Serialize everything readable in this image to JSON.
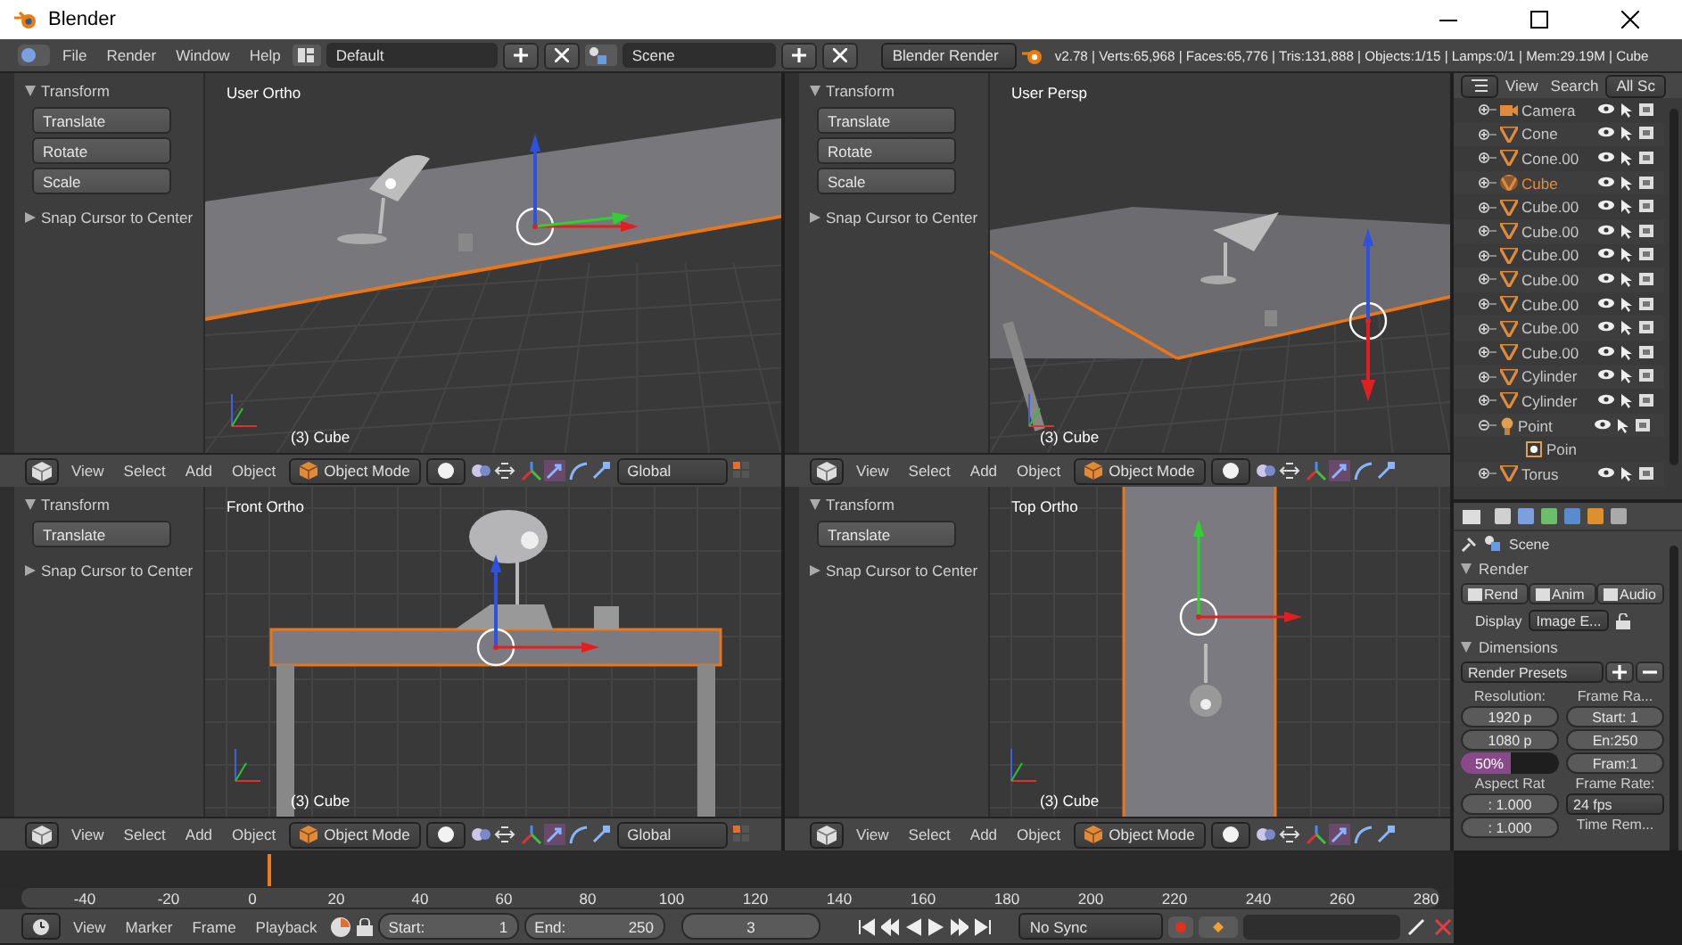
{
  "window": {
    "title": "Blender"
  },
  "info_header": {
    "menus": [
      "File",
      "Render",
      "Window",
      "Help"
    ],
    "screen_layout": "Default",
    "scene": "Scene",
    "render_engine": "Blender Render",
    "stats": "v2.78 | Verts:65,968 | Faces:65,776 | Tris:131,888 | Objects:1/15 | Lamps:0/1 | Mem:29.19M | Cube"
  },
  "viewports": [
    {
      "kind": "user_ortho",
      "view_label": "User Ortho",
      "object_label": "(3) Cube",
      "tool_shelf": {
        "panel": "Transform",
        "tools": [
          "Translate",
          "Rotate",
          "Scale"
        ],
        "collapsed_panel": "Snap Cursor to Center"
      },
      "header": {
        "menus": [
          "View",
          "Select",
          "Add",
          "Object"
        ],
        "mode": "Object Mode",
        "orientation": "Global"
      }
    },
    {
      "kind": "user_persp",
      "view_label": "User Persp",
      "object_label": "(3) Cube",
      "tool_shelf": {
        "panel": "Transform",
        "tools": [
          "Translate",
          "Rotate",
          "Scale"
        ],
        "collapsed_panel": "Snap Cursor to Center"
      },
      "header": {
        "menus": [
          "View",
          "Select",
          "Add",
          "Object"
        ],
        "mode": "Object Mode"
      }
    },
    {
      "kind": "front_ortho",
      "view_label": "Front Ortho",
      "object_label": "(3) Cube",
      "tool_shelf": {
        "panel": "Transform",
        "tools": [
          "Translate"
        ],
        "collapsed_panel": "Snap Cursor to Center"
      },
      "header": {
        "menus": [
          "View",
          "Select",
          "Add",
          "Object"
        ],
        "mode": "Object Mode",
        "orientation": "Global"
      }
    },
    {
      "kind": "top_ortho",
      "view_label": "Top Ortho",
      "object_label": "(3) Cube",
      "tool_shelf": {
        "panel": "Transform",
        "tools": [
          "Translate"
        ],
        "collapsed_panel": "Snap Cursor to Center"
      },
      "header": {
        "menus": [
          "View",
          "Select",
          "Add",
          "Object"
        ],
        "mode": "Object Mode"
      }
    }
  ],
  "outliner": {
    "menus": [
      "View",
      "Search"
    ],
    "filter": "All Sc",
    "items": [
      {
        "name": "Camera",
        "kind": "camera",
        "selected": false,
        "expanded": false
      },
      {
        "name": "Cone",
        "kind": "mesh",
        "selected": false,
        "expanded": false
      },
      {
        "name": "Cone.00",
        "kind": "mesh",
        "selected": false,
        "expanded": false
      },
      {
        "name": "Cube",
        "kind": "mesh",
        "selected": true,
        "expanded": false
      },
      {
        "name": "Cube.00",
        "kind": "mesh",
        "selected": false,
        "expanded": false
      },
      {
        "name": "Cube.00",
        "kind": "mesh",
        "selected": false,
        "expanded": false
      },
      {
        "name": "Cube.00",
        "kind": "mesh",
        "selected": false,
        "expanded": false
      },
      {
        "name": "Cube.00",
        "kind": "mesh",
        "selected": false,
        "expanded": false
      },
      {
        "name": "Cube.00",
        "kind": "mesh",
        "selected": false,
        "expanded": false
      },
      {
        "name": "Cube.00",
        "kind": "mesh",
        "selected": false,
        "expanded": false
      },
      {
        "name": "Cube.00",
        "kind": "mesh",
        "selected": false,
        "expanded": false
      },
      {
        "name": "Cylinder",
        "kind": "mesh",
        "selected": false,
        "expanded": false
      },
      {
        "name": "Cylinder",
        "kind": "mesh",
        "selected": false,
        "expanded": false
      },
      {
        "name": "Point",
        "kind": "lamp",
        "selected": false,
        "expanded": true,
        "children": [
          {
            "name": "Poin",
            "kind": "lamp_data",
            "selected": false
          }
        ]
      },
      {
        "name": "Torus",
        "kind": "mesh",
        "selected": false,
        "expanded": false
      }
    ]
  },
  "properties": {
    "context": "Scene",
    "render_panel": {
      "title": "Render",
      "buttons": [
        "Rend",
        "Anim",
        "Audio"
      ],
      "display_label": "Display",
      "display_value": "Image E..."
    },
    "dimensions_panel": {
      "title": "Dimensions",
      "presets": "Render Presets",
      "resolution_label": "Resolution:",
      "resolution_x": "1920 p",
      "resolution_y": "1080 p",
      "percentage": "50%",
      "level": 0.5,
      "frame_range_label": "Frame Ra...",
      "frame_start": "Start: 1",
      "frame_end": "En:250",
      "frame_step": "Fram:1",
      "aspect_label": "Aspect Rat",
      "aspect_x": ": 1.000",
      "aspect_y": ": 1.000",
      "frame_rate_label": "Frame Rate:",
      "frame_rate": "24 fps",
      "time_remapping_label": "Time Rem..."
    }
  },
  "timeline": {
    "ruler_ticks": [
      "-40",
      "-20",
      "0",
      "20",
      "40",
      "60",
      "80",
      "100",
      "120",
      "140",
      "160",
      "180",
      "200",
      "220",
      "240",
      "260",
      "280"
    ],
    "menus": [
      "View",
      "Marker",
      "Frame",
      "Playback"
    ],
    "start_label": "Start:",
    "start_value": "1",
    "end_label": "End:",
    "end_value": "250",
    "current_frame": "3",
    "sync": "No Sync"
  }
}
